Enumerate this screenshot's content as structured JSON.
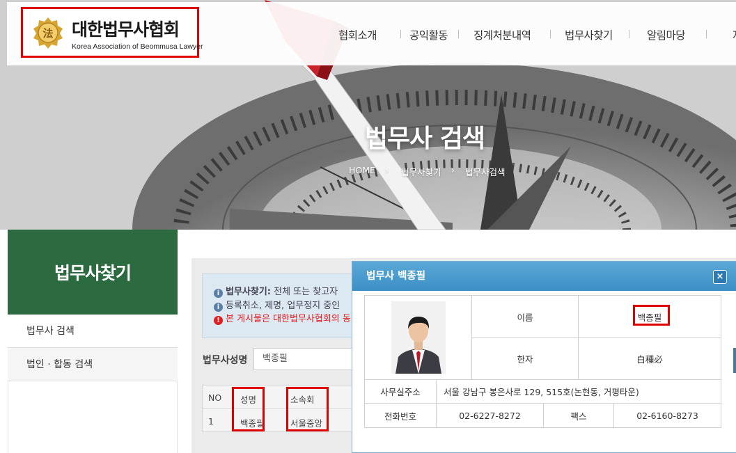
{
  "header": {
    "logo_title": "대한법무사협회",
    "logo_subtitle": "Korea Association of Beommusa Lawyer",
    "logo_emblem_text": "法",
    "nav": [
      "협회소개",
      "공익활동",
      "징계처분내역",
      "법무사찾기",
      "알림마당",
      "자"
    ]
  },
  "hero": {
    "title": "법무사 검색",
    "breadcrumb": [
      "HOME",
      "법무사찾기",
      "법무사검색"
    ]
  },
  "sidebar": {
    "title": "법무사찾기",
    "items": [
      "법무사 검색",
      "법인 · 합동 검색"
    ]
  },
  "notice": {
    "line1_bold": "법무사찾기:",
    "line1_rest": " 전체 또는 찾고자",
    "line2": "등록취소, 제명, 업무정지 중인",
    "line3": "본 게시물은 대한법무사협회의 동"
  },
  "search": {
    "label": "법무사성명",
    "value": "백종필"
  },
  "results": {
    "headers": [
      "NO",
      "성명",
      "소속회"
    ],
    "rows": [
      [
        "1",
        "백종필",
        "서울중앙"
      ]
    ]
  },
  "popup": {
    "title": "법무사 백종필",
    "close": "×",
    "name_label": "이름",
    "name_value": "백종필",
    "hanja_label": "한자",
    "hanja_value": "白種必",
    "address_label": "사무실주소",
    "address_value": "서울 강남구 봉은사로 129, 515호(논현동, 거평타운)",
    "phone_label": "전화번호",
    "phone_value": "02-6227-8272",
    "fax_label": "팩스",
    "fax_value": "02-6160-8273"
  },
  "colors": {
    "sidebar_green": "#2c6a3f",
    "popup_blue": "#4a9bcf",
    "highlight_red": "#e00000",
    "notice_red": "#e02020"
  }
}
